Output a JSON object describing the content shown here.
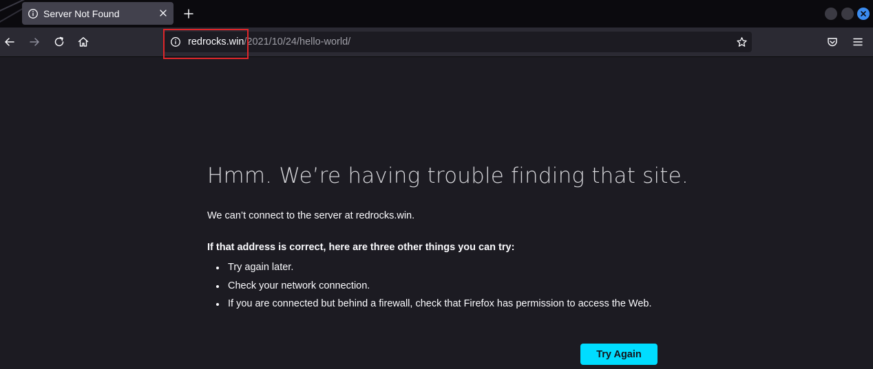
{
  "window": {
    "tab_title": "Server Not Found"
  },
  "urlbar": {
    "host": "redrocks.win",
    "path": "/2021/10/24/hello-world/"
  },
  "icons": {
    "tab": "info-icon",
    "tab_close": "close-icon",
    "new_tab": "plus-icon",
    "back": "arrow-left-icon",
    "forward": "arrow-right-icon",
    "reload": "reload-icon",
    "home": "home-icon",
    "site_info": "info-icon",
    "bookmark": "star-icon",
    "pocket": "pocket-icon",
    "menu": "hamburger-menu-icon"
  },
  "error_page": {
    "title": "Hmm. We’re having trouble finding that site.",
    "description": "We can’t connect to the server at redrocks.win.",
    "suggestions_heading": "If that address is correct, here are three other things you can try:",
    "suggestions": [
      "Try again later.",
      "Check your network connection.",
      "If you are connected but behind a firewall, check that Firefox has permission to access the Web."
    ],
    "try_again_label": "Try Again"
  },
  "colors": {
    "accent": "#00ddff",
    "highlight": "#e0262a",
    "background": "#1c1b22",
    "toolbar": "#2b2a33",
    "tabbar": "#0b0a0e"
  }
}
